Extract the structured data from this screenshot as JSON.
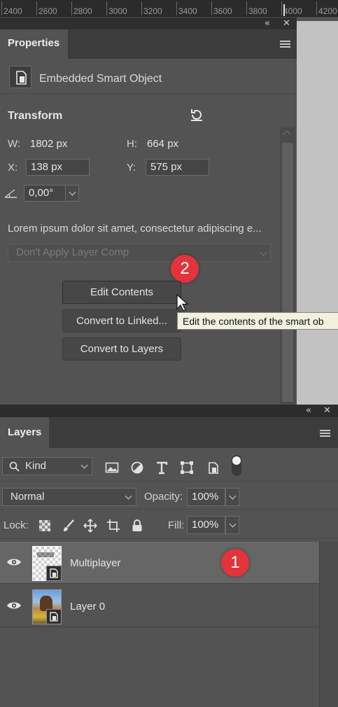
{
  "ruler": {
    "labels": [
      "2400",
      "2600",
      "2800",
      "3000",
      "3200",
      "3400",
      "3600",
      "3800",
      "4000",
      "4200"
    ]
  },
  "properties": {
    "tab_label": "Properties",
    "object_type": "Embedded Smart Object",
    "transform_title": "Transform",
    "w_label": "W:",
    "w_value": "1802 px",
    "h_label": "H:",
    "h_value": "664 px",
    "x_label": "X:",
    "x_value": "138 px",
    "y_label": "Y:",
    "y_value": "575 px",
    "angle_value": "0,00°",
    "description": "Lorem ipsum dolor sit amet, consectetur adipiscing e...",
    "layer_comp": "Don't Apply Layer Comp",
    "buttons": {
      "edit_contents": "Edit Contents",
      "convert_linked": "Convert to Linked...",
      "convert_layers": "Convert to Layers"
    },
    "tooltip": "Edit the contents of the smart ob",
    "badge": "2"
  },
  "layers": {
    "tab_label": "Layers",
    "filter_kind": "Kind",
    "blend_mode": "Normal",
    "opacity_label": "Opacity:",
    "opacity_value": "100%",
    "lock_label": "Lock:",
    "fill_label": "Fill:",
    "fill_value": "100%",
    "items": [
      {
        "name": "Multiplayer",
        "selected": true
      },
      {
        "name": "Layer 0",
        "selected": false
      }
    ],
    "badge": "1"
  },
  "colors": {
    "panel_bg": "#535353",
    "badge_red": "#e2343b",
    "tooltip_bg": "#f1f1de"
  }
}
